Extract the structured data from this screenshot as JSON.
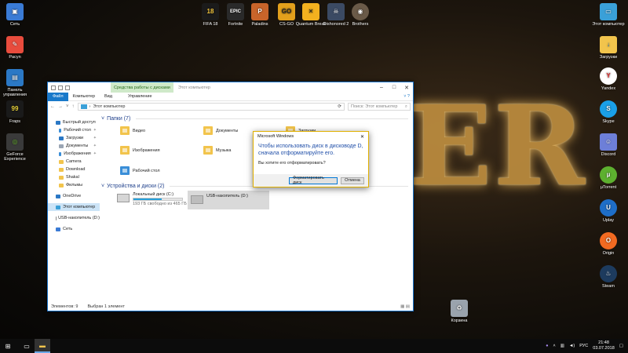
{
  "desktop": {
    "bg_text": "ER",
    "icons_left": [
      {
        "label": "Сеть",
        "icon": "network-icon",
        "color": "#3a7bd5"
      },
      {
        "label": "Pacyn",
        "icon": "paint-icon",
        "color": "#e84c3d"
      },
      {
        "label": "Панель управления",
        "icon": "control-panel-icon",
        "color": "#2b78c5"
      },
      {
        "label": "Fraps",
        "icon": "fraps-icon",
        "color": "#e8d23a"
      },
      {
        "label": "GeForce Experience",
        "icon": "geforce-icon",
        "color": "#6bb531"
      }
    ],
    "icons_top": [
      {
        "label": "FIFA 18",
        "icon": "fifa-icon",
        "color": "#1b1b1b",
        "glyph": "18"
      },
      {
        "label": "Fortnite",
        "icon": "epic-games-icon",
        "color": "#2a2a2a",
        "glyph": "EPIC"
      },
      {
        "label": "Paladins",
        "icon": "paladins-icon",
        "color": "#c8642a",
        "glyph": "P"
      },
      {
        "label": "CS-GO",
        "icon": "csgo-icon",
        "color": "#e3a01c",
        "glyph": "GO"
      },
      {
        "label": "Quantum Break",
        "icon": "quantum-break-icon",
        "color": "#f3b11f",
        "glyph": "X"
      },
      {
        "label": "Dishonored 2",
        "icon": "dishonored-icon",
        "color": "#3b4a63",
        "glyph": "D"
      },
      {
        "label": "Brothers",
        "icon": "brothers-icon",
        "color": "#6a5a48",
        "glyph": "B"
      }
    ],
    "icons_right": [
      {
        "label": "Этот компьютер",
        "icon": "computer-icon",
        "color": "#3aa0d8"
      },
      {
        "label": "Загрузки",
        "icon": "downloads-icon",
        "color": "#f2c44c"
      },
      {
        "label": "Yandex",
        "icon": "yandex-icon",
        "color": "#e02b2b"
      },
      {
        "label": "Skype",
        "icon": "skype-icon",
        "color": "#1aa0e8"
      },
      {
        "label": "Discord",
        "icon": "discord-icon",
        "color": "#6d7fd8"
      },
      {
        "label": "µTorrent",
        "icon": "utorrent-icon",
        "color": "#5db02f"
      },
      {
        "label": "Uplay",
        "icon": "uplay-icon",
        "color": "#1e6ec8"
      },
      {
        "label": "Origin",
        "icon": "origin-icon",
        "color": "#f26a21"
      },
      {
        "label": "Steam",
        "icon": "steam-icon",
        "color": "#1d3b5e"
      }
    ],
    "recycle_bin": "Корзина"
  },
  "explorer": {
    "context_tab": "Средства работы с дисками",
    "title": "Этот компьютер",
    "ribbon": {
      "file": "Файл",
      "computer": "Компьютер",
      "view": "Вид",
      "manage": "Управление"
    },
    "address": "Этот компьютер",
    "search_placeholder": "Поиск: Этот компьютер",
    "nav": [
      {
        "label": "Быстрый доступ",
        "color": "#2b78c5",
        "sub": false,
        "pin": false,
        "sel": false
      },
      {
        "label": "Рабочий стол",
        "color": "#3a8ed8",
        "sub": true,
        "pin": true,
        "sel": false
      },
      {
        "label": "Загрузки",
        "color": "#2b78c5",
        "sub": true,
        "pin": true,
        "sel": false
      },
      {
        "label": "Документы",
        "color": "#9aa5b3",
        "sub": true,
        "pin": true,
        "sel": false
      },
      {
        "label": "Изображения",
        "color": "#3a8ed8",
        "sub": true,
        "pin": true,
        "sel": false
      },
      {
        "label": "Camera",
        "color": "#f2c44c",
        "sub": true,
        "pin": false,
        "sel": false
      },
      {
        "label": "Download",
        "color": "#f2c44c",
        "sub": true,
        "pin": false,
        "sel": false
      },
      {
        "label": "Shakal",
        "color": "#f2c44c",
        "sub": true,
        "pin": false,
        "sel": false
      },
      {
        "label": "Фильмы",
        "color": "#f2c44c",
        "sub": true,
        "pin": false,
        "sel": false
      },
      {
        "label": "OneDrive",
        "color": "#2b78c5",
        "sub": false,
        "pin": false,
        "sel": false
      },
      {
        "label": "Этот компьютер",
        "color": "#3aa0d8",
        "sub": false,
        "pin": false,
        "sel": true
      },
      {
        "label": "USB-накопитель (D:)",
        "color": "#8c8c8c",
        "sub": false,
        "pin": false,
        "sel": false
      },
      {
        "label": "Сеть",
        "color": "#3a7bd5",
        "sub": false,
        "pin": false,
        "sel": false
      }
    ],
    "folders_header": "Папки (7)",
    "folders": [
      "Видео",
      "Документы",
      "Загрузки",
      "Изображения",
      "Музыка",
      "Рабочий стол"
    ],
    "devices_header": "Устройства и диски (2)",
    "drives": [
      {
        "name": "Локальный диск (C:)",
        "free": "193 ГБ свободно из 465 ГБ",
        "used_fraction": 0.585
      },
      {
        "name": "USB-накопитель (D:)"
      }
    ],
    "status": {
      "count": "Элементов: 9",
      "selected": "Выбран 1 элемент"
    }
  },
  "dialog": {
    "title": "Microsoft Windows",
    "message": "Чтобы использовать диск в дисководе D, сначала отформатируйте его.",
    "question": "Вы хотите его отформатировать?",
    "format_button": "Форматировать диск",
    "cancel_button": "Отмена"
  },
  "taskbar": {
    "tray_lang": "РУС",
    "time": "21:48",
    "date": "03.07.2018"
  }
}
